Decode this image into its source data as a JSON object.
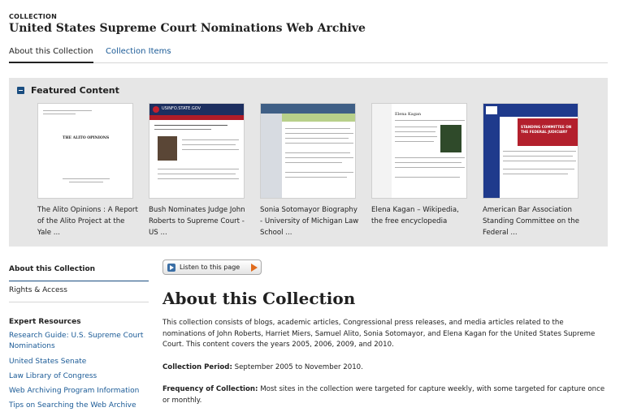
{
  "header": {
    "eyebrow": "COLLECTION",
    "title": "United States Supreme Court Nominations Web Archive"
  },
  "tabs": [
    {
      "label": "About this Collection",
      "active": true
    },
    {
      "label": "Collection Items",
      "active": false
    }
  ],
  "featured": {
    "heading": "Featured Content",
    "items": [
      {
        "caption": "The Alito Opinions : A Report of the Alito Project at the Yale ...",
        "thumb_text": "THE ALITO OPINIONS"
      },
      {
        "caption": "Bush Nominates Judge John Roberts to Supreme Court - US ...",
        "thumb_text": "USINFO.STATE.GOV"
      },
      {
        "caption": "Sonia Sotomayor Biography - University of Michigan Law School ...",
        "thumb_text": ""
      },
      {
        "caption": "Elena Kagan – Wikipedia, the free encyclopedia",
        "thumb_text": "Elena Kagan"
      },
      {
        "caption": "American Bar Association Standing Committee on the Federal ...",
        "thumb_text": "STANDING COMMITTEE ON THE FEDERAL JUDICIARY"
      }
    ]
  },
  "sidebar": {
    "active_item": "About this Collection",
    "rights_item": "Rights & Access",
    "expert_heading": "Expert Resources",
    "links": [
      "Research Guide: U.S. Supreme Court Nominations",
      "United States Senate",
      "Law Library of Congress",
      "Web Archiving Program Information",
      "Tips on Searching the Web Archive"
    ]
  },
  "listen": {
    "label": "Listen to this page"
  },
  "main": {
    "title": "About this Collection",
    "intro": "This collection consists of blogs, academic articles, Congressional press releases, and media articles related to the nominations of John Roberts, Harriet Miers, Samuel Alito, Sonia Sotomayor, and Elena Kagan for the United States Supreme Court. This content covers the years 2005, 2006, 2009, and 2010.",
    "period_label": "Collection Period:",
    "period_value": "September 2005 to November 2010.",
    "frequency_label": "Frequency of Collection:",
    "frequency_value": "Most sites in the collection were targeted for capture weekly, with some targeted for capture once or monthly."
  },
  "colors": {
    "link": "#1a5a96",
    "featured_bg": "#e6e6e6",
    "accent_dark": "#1a4d80",
    "play_orange": "#e06b1c"
  }
}
